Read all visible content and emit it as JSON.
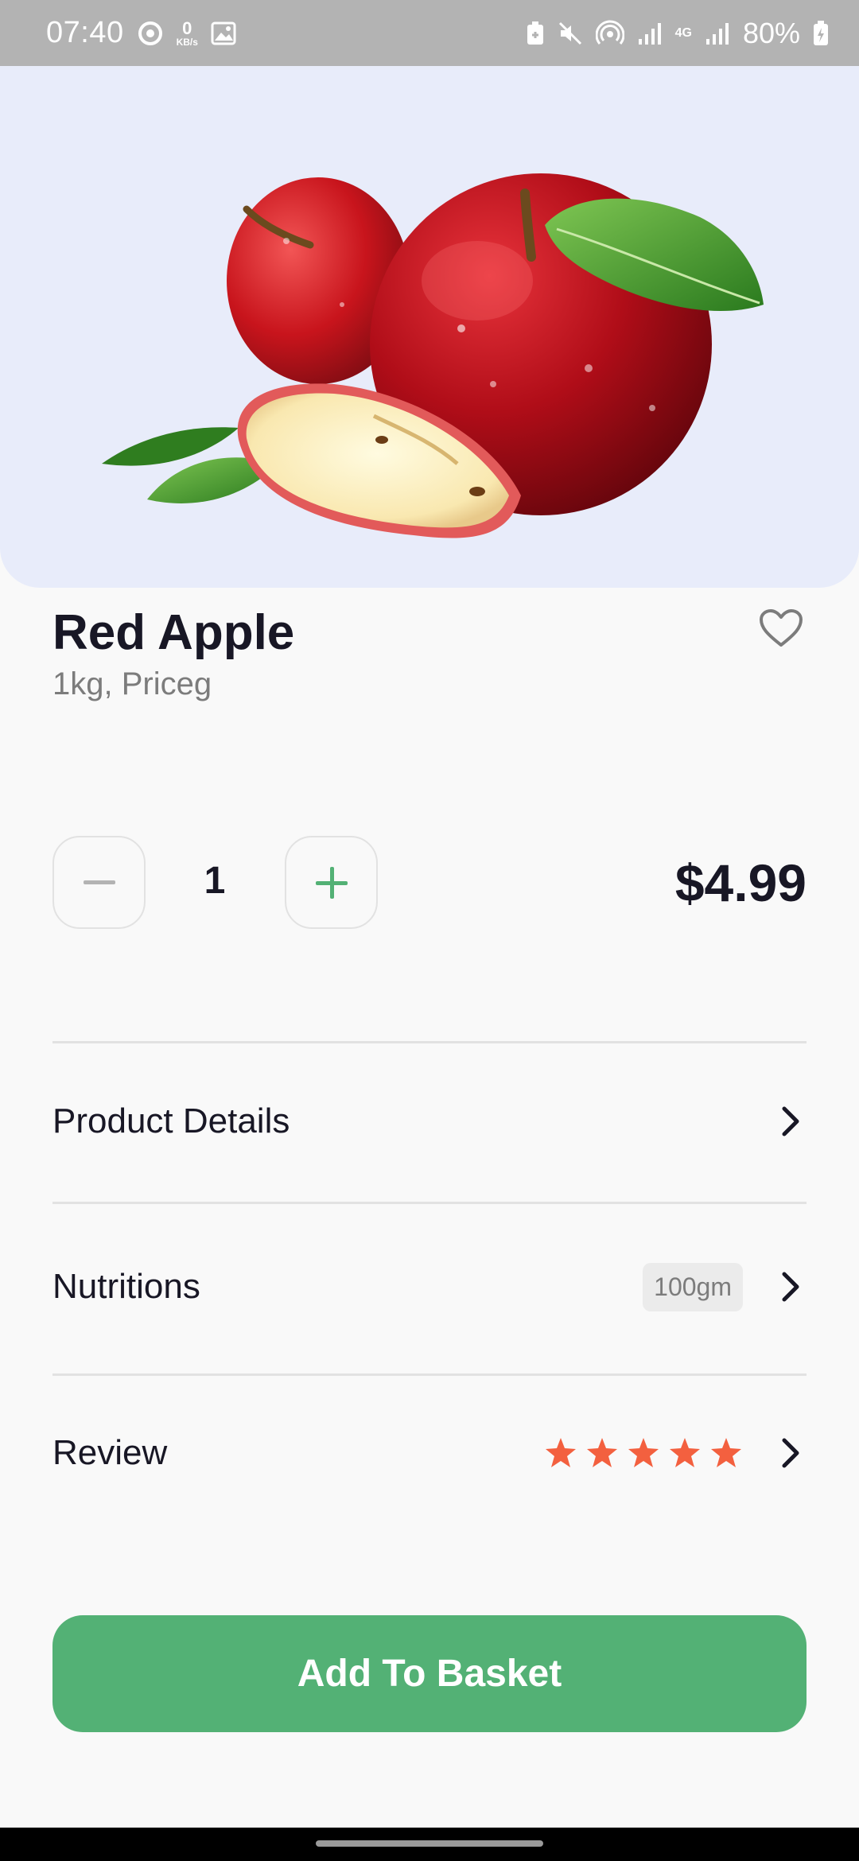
{
  "status_bar": {
    "time": "07:40",
    "data_rate_value": "0",
    "data_rate_unit": "KB/s",
    "network": "4G",
    "battery": "80%",
    "icons": [
      "sync-icon",
      "image-icon",
      "battery-saver-icon",
      "mute-icon",
      "hotspot-icon",
      "signal-icon",
      "4g-icon",
      "signal-icon",
      "battery-charging-icon"
    ]
  },
  "product": {
    "name": "Red Apple",
    "subtitle": "1kg, Priceg",
    "image_icon": "apple-photo",
    "favorite_icon": "heart-outline-icon"
  },
  "quantity": {
    "value": "1",
    "minus_icon": "minus-icon",
    "plus_icon": "plus-icon"
  },
  "price": "$4.99",
  "sections": {
    "details_label": "Product Details",
    "nutritions_label": "Nutritions",
    "nutritions_badge": "100gm",
    "review_label": "Review",
    "review_rating": 5,
    "review_max": 5
  },
  "cta": {
    "label": "Add To Basket"
  },
  "colors": {
    "accent": "#53B175",
    "star": "#F3603F",
    "hero_bg": "#E8ECFA",
    "text_primary": "#181725",
    "text_secondary": "#7C7C7C"
  }
}
